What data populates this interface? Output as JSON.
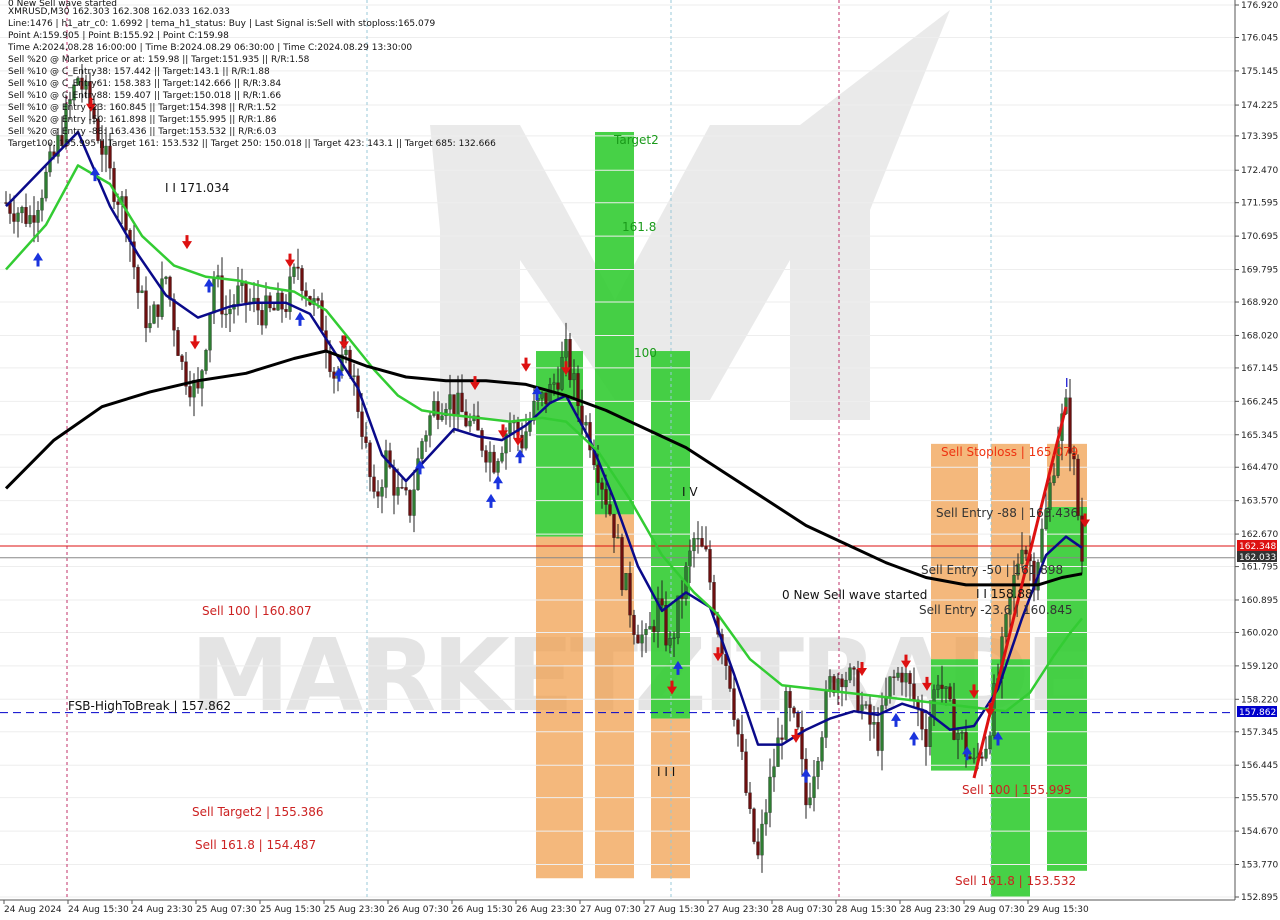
{
  "header": {
    "lines": [
      "0 New Sell wave started",
      "XMRUSD,M30  162.303 162.308 162.033 162.033",
      "Line:1476  |  h1_atr_c0: 1.6992  |  tema_h1_status: Buy  |  Last Signal is:Sell with stoploss:165.079",
      "Point A:159.905  |  Point B:155.92  |  Point C:159.98",
      "Time A:2024.08.28 16:00:00  |  Time B:2024.08.29 06:30:00  |  Time C:2024.08.29 13:30:00",
      "Sell %20 @ Market price or at: 159.98  ||  Target:151.935  ||  R/R:1.58",
      "Sell %10 @ C_Entry38: 157.442  ||  Target:143.1  ||  R/R:1.88",
      "Sell %10 @ C_Entry61: 158.383  ||  Target:142.666  ||  R/R:3.84",
      "Sell %10 @ C_Entry88: 159.407  ||  Target:150.018  ||  R/R:1.66",
      "Sell %10 @ Entry -23: 160.845  ||  Target:154.398  ||  R/R:1.52",
      "Sell %20 @ Entry -50: 161.898  ||  Target:155.995  ||  R/R:1.86",
      "Sell %20 @ Entry -88: 163.436  ||  Target:153.532  ||  R/R:6.03",
      "Target100: 155.995  ||  Target 161: 153.532  ||  Target 250: 150.018  ||  Target 423: 143.1  ||  Target 685: 132.666"
    ]
  },
  "watermark": "MARKETZITRADE",
  "annotations": {
    "level_171": "I I 171.034",
    "target2": "Target2",
    "fib_161": "161.8",
    "fib_100": "100",
    "wave_iv": "I V",
    "wave_iii": "I I I",
    "wave_i": "I",
    "new_sell_wave": "0 New Sell wave started",
    "sell_100_left": "Sell 100 | 160.807",
    "sell_target2": "Sell Target2 | 155.386",
    "sell_161_left": "Sell 161.8 | 154.487",
    "fsb": "FSB-HighToBreak  |  157.862",
    "sell_stoploss": "Sell Stoploss | 165.079",
    "sell_entry_88": "Sell Entry -88 | 163.436",
    "sell_entry_50": "Sell Entry -50 | 161.898",
    "sell_entry_23": "Sell Entry -23.6 | 160.845",
    "sell_100_right": "Sell 100 | 155.995",
    "sell_161_right": "Sell 161.8 | 153.532",
    "partial_level": "I I 158.88"
  },
  "price_tags": {
    "ask": "162.348",
    "bid": "162.033",
    "fsb": "157.862"
  },
  "colors": {
    "green": "#33cc33",
    "orange": "#f0a050",
    "red": "#dd1111",
    "navy": "#0a0a8a",
    "ma_green": "#33cc33",
    "ma_black": "#000000",
    "fsb_blue": "#0000cc",
    "annotation_red": "#cc2222"
  },
  "chart_data": {
    "type": "candlestick",
    "symbol": "XMRUSD",
    "timeframe": "M30",
    "ylim": [
      152.895,
      176.92
    ],
    "y_ticks": [
      "176.920",
      "176.045",
      "175.145",
      "174.225",
      "173.395",
      "172.470",
      "171.595",
      "170.695",
      "169.795",
      "168.920",
      "168.020",
      "167.145",
      "166.245",
      "165.345",
      "164.470",
      "163.570",
      "162.670",
      "161.795",
      "160.895",
      "160.020",
      "159.120",
      "158.220",
      "157.345",
      "156.445",
      "155.570",
      "154.670",
      "153.770",
      "152.895"
    ],
    "x_ticks": [
      "24 Aug 2024",
      "24 Aug 15:30",
      "24 Aug 23:30",
      "25 Aug 07:30",
      "25 Aug 15:30",
      "25 Aug 23:30",
      "26 Aug 07:30",
      "26 Aug 15:30",
      "26 Aug 23:30",
      "27 Aug 07:30",
      "27 Aug 15:30",
      "27 Aug 23:30",
      "28 Aug 07:30",
      "28 Aug 15:30",
      "28 Aug 23:30",
      "29 Aug 07:30",
      "29 Aug 15:30"
    ],
    "n_bars": 270,
    "close_anchors": [
      [
        0,
        171.6
      ],
      [
        6,
        171.2
      ],
      [
        12,
        172.8
      ],
      [
        18,
        175.0
      ],
      [
        22,
        173.9
      ],
      [
        26,
        172.3
      ],
      [
        30,
        171.3
      ],
      [
        33,
        169.2
      ],
      [
        36,
        168.2
      ],
      [
        40,
        169.6
      ],
      [
        44,
        167.2
      ],
      [
        48,
        166.4
      ],
      [
        52,
        169.6
      ],
      [
        55,
        168.6
      ],
      [
        58,
        169.1
      ],
      [
        62,
        168.8
      ],
      [
        66,
        168.6
      ],
      [
        70,
        168.9
      ],
      [
        73,
        169.9
      ],
      [
        76,
        169.0
      ],
      [
        79,
        168.4
      ],
      [
        82,
        167.0
      ],
      [
        86,
        167.3
      ],
      [
        89,
        165.6
      ],
      [
        92,
        163.4
      ],
      [
        95,
        164.7
      ],
      [
        98,
        163.7
      ],
      [
        101,
        163.4
      ],
      [
        104,
        165.2
      ],
      [
        107,
        166.1
      ],
      [
        110,
        166.4
      ],
      [
        114,
        165.9
      ],
      [
        118,
        165.3
      ],
      [
        122,
        164.7
      ],
      [
        126,
        165.7
      ],
      [
        129,
        165.2
      ],
      [
        132,
        166.0
      ],
      [
        136,
        166.5
      ],
      [
        140,
        167.5
      ],
      [
        143,
        166.2
      ],
      [
        146,
        165.3
      ],
      [
        149,
        164.1
      ],
      [
        152,
        162.9
      ],
      [
        154,
        161.6
      ],
      [
        157,
        160.3
      ],
      [
        160,
        159.7
      ],
      [
        163,
        160.7
      ],
      [
        166,
        159.6
      ],
      [
        169,
        161.1
      ],
      [
        172,
        162.5
      ],
      [
        175,
        162.0
      ],
      [
        178,
        160.2
      ],
      [
        181,
        158.8
      ],
      [
        184,
        156.5
      ],
      [
        186,
        154.9
      ],
      [
        188,
        153.9
      ],
      [
        190,
        155.3
      ],
      [
        192,
        156.5
      ],
      [
        195,
        158.0
      ],
      [
        198,
        157.2
      ],
      [
        200,
        155.4
      ],
      [
        203,
        157.0
      ],
      [
        206,
        158.6
      ],
      [
        209,
        159.0
      ],
      [
        212,
        158.6
      ],
      [
        215,
        157.7
      ],
      [
        218,
        157.2
      ],
      [
        221,
        158.6
      ],
      [
        224,
        159.0
      ],
      [
        227,
        158.2
      ],
      [
        230,
        157.3
      ],
      [
        233,
        158.9
      ],
      [
        236,
        157.8
      ],
      [
        239,
        157.1
      ],
      [
        242,
        156.4
      ],
      [
        245,
        157.1
      ],
      [
        248,
        158.8
      ],
      [
        251,
        160.8
      ],
      [
        254,
        162.6
      ],
      [
        257,
        161.6
      ],
      [
        260,
        163.2
      ],
      [
        263,
        165.4
      ],
      [
        265,
        166.0
      ],
      [
        267,
        164.4
      ],
      [
        269,
        162.0
      ]
    ],
    "moving_averages": [
      {
        "name": "",
        "color": "#0a0a8a",
        "points": [
          [
            0,
            171.5
          ],
          [
            18,
            173.5
          ],
          [
            26,
            171.5
          ],
          [
            33,
            170.2
          ],
          [
            40,
            169.1
          ],
          [
            48,
            168.5
          ],
          [
            56,
            168.8
          ],
          [
            62,
            168.9
          ],
          [
            70,
            168.9
          ],
          [
            76,
            168.6
          ],
          [
            82,
            167.6
          ],
          [
            88,
            166.6
          ],
          [
            94,
            164.8
          ],
          [
            100,
            164.1
          ],
          [
            106,
            164.8
          ],
          [
            112,
            165.5
          ],
          [
            118,
            165.3
          ],
          [
            124,
            165.2
          ],
          [
            130,
            165.6
          ],
          [
            136,
            166.2
          ],
          [
            140,
            166.4
          ],
          [
            146,
            165.2
          ],
          [
            152,
            163.6
          ],
          [
            158,
            161.8
          ],
          [
            164,
            160.6
          ],
          [
            170,
            161.1
          ],
          [
            176,
            160.7
          ],
          [
            182,
            158.9
          ],
          [
            188,
            157.0
          ],
          [
            194,
            157.0
          ],
          [
            200,
            157.4
          ],
          [
            206,
            157.7
          ],
          [
            212,
            157.9
          ],
          [
            218,
            157.8
          ],
          [
            224,
            158.1
          ],
          [
            230,
            157.9
          ],
          [
            236,
            157.4
          ],
          [
            242,
            157.5
          ],
          [
            248,
            158.5
          ],
          [
            254,
            160.4
          ],
          [
            260,
            162.1
          ],
          [
            265,
            162.6
          ],
          [
            269,
            162.3
          ]
        ]
      },
      {
        "name": "",
        "color": "#33cc33",
        "points": [
          [
            0,
            169.8
          ],
          [
            10,
            171.0
          ],
          [
            18,
            172.6
          ],
          [
            26,
            172.1
          ],
          [
            34,
            170.7
          ],
          [
            42,
            169.9
          ],
          [
            50,
            169.6
          ],
          [
            58,
            169.5
          ],
          [
            66,
            169.3
          ],
          [
            72,
            169.2
          ],
          [
            80,
            168.7
          ],
          [
            86,
            167.9
          ],
          [
            92,
            167.1
          ],
          [
            98,
            166.4
          ],
          [
            104,
            166.0
          ],
          [
            110,
            165.9
          ],
          [
            118,
            165.8
          ],
          [
            126,
            165.7
          ],
          [
            134,
            165.8
          ],
          [
            140,
            165.7
          ],
          [
            148,
            164.9
          ],
          [
            156,
            163.6
          ],
          [
            164,
            162.1
          ],
          [
            172,
            161.1
          ],
          [
            178,
            160.5
          ],
          [
            186,
            159.3
          ],
          [
            194,
            158.6
          ],
          [
            202,
            158.5
          ],
          [
            210,
            158.4
          ],
          [
            218,
            158.3
          ],
          [
            226,
            158.2
          ],
          [
            234,
            158.1
          ],
          [
            242,
            158.0
          ],
          [
            250,
            157.9
          ],
          [
            256,
            158.4
          ],
          [
            262,
            159.4
          ],
          [
            266,
            160.0
          ],
          [
            269,
            160.4
          ]
        ]
      },
      {
        "name": "",
        "color": "#000000",
        "points": [
          [
            0,
            163.9
          ],
          [
            12,
            165.2
          ],
          [
            24,
            166.1
          ],
          [
            36,
            166.5
          ],
          [
            48,
            166.8
          ],
          [
            60,
            167.0
          ],
          [
            72,
            167.4
          ],
          [
            80,
            167.6
          ],
          [
            90,
            167.2
          ],
          [
            100,
            166.9
          ],
          [
            110,
            166.8
          ],
          [
            120,
            166.8
          ],
          [
            130,
            166.7
          ],
          [
            140,
            166.4
          ],
          [
            150,
            166.0
          ],
          [
            160,
            165.5
          ],
          [
            170,
            165.0
          ],
          [
            180,
            164.3
          ],
          [
            190,
            163.6
          ],
          [
            200,
            162.9
          ],
          [
            210,
            162.4
          ],
          [
            220,
            161.9
          ],
          [
            230,
            161.5
          ],
          [
            240,
            161.3
          ],
          [
            250,
            161.3
          ],
          [
            258,
            161.3
          ],
          [
            264,
            161.5
          ],
          [
            269,
            161.6
          ]
        ]
      }
    ],
    "zones": [
      {
        "color": "green",
        "x0": 536,
        "x1": 583,
        "top": 167.6,
        "bottom": 162.6
      },
      {
        "color": "orange",
        "x0": 536,
        "x1": 583,
        "top": 162.6,
        "bottom": 153.4
      },
      {
        "color": "green",
        "x0": 595,
        "x1": 634,
        "top": 173.5,
        "bottom": 163.2
      },
      {
        "color": "orange",
        "x0": 595,
        "x1": 634,
        "top": 163.2,
        "bottom": 153.4
      },
      {
        "color": "green",
        "x0": 651,
        "x1": 690,
        "top": 167.6,
        "bottom": 157.7
      },
      {
        "color": "orange",
        "x0": 651,
        "x1": 690,
        "top": 157.7,
        "bottom": 153.4
      },
      {
        "color": "orange",
        "x0": 931,
        "x1": 978,
        "top": 165.1,
        "bottom": 159.3
      },
      {
        "color": "green",
        "x0": 931,
        "x1": 978,
        "top": 159.3,
        "bottom": 156.3
      },
      {
        "color": "orange",
        "x0": 991,
        "x1": 1030,
        "top": 165.1,
        "bottom": 159.3
      },
      {
        "color": "green",
        "x0": 991,
        "x1": 1030,
        "top": 159.3,
        "bottom": 152.9
      },
      {
        "color": "orange",
        "x0": 1047,
        "x1": 1087,
        "top": 165.1,
        "bottom": 163.4
      },
      {
        "color": "green",
        "x0": 1047,
        "x1": 1087,
        "top": 163.4,
        "bottom": 153.6
      }
    ],
    "vlines": [
      {
        "x": 67,
        "color": "#c0306a"
      },
      {
        "x": 367,
        "color": "#99c8d8"
      },
      {
        "x": 671,
        "color": "#99c8d8"
      },
      {
        "x": 839,
        "color": "#c0306a"
      },
      {
        "x": 991,
        "color": "#99c8d8"
      }
    ],
    "hlines": [
      {
        "price": 162.348,
        "color": "#dd1111",
        "style": "solid"
      },
      {
        "price": 162.033,
        "color": "#888888",
        "style": "solid"
      },
      {
        "price": 157.862,
        "color": "#0000cc",
        "style": "dashed"
      }
    ],
    "red_line": {
      "from": [
        974,
        156.1
      ],
      "to": [
        1066,
        166.1
      ]
    },
    "sell_arrows": [
      [
        91,
        174.1
      ],
      [
        187,
        170.4
      ],
      [
        290,
        169.9
      ],
      [
        195,
        167.7
      ],
      [
        344,
        167.7
      ],
      [
        475,
        166.6
      ],
      [
        526,
        167.1
      ],
      [
        566,
        167.0
      ],
      [
        503,
        165.3
      ],
      [
        518,
        165.1
      ],
      [
        906,
        159.1
      ],
      [
        862,
        158.9
      ],
      [
        927,
        158.5
      ],
      [
        974,
        158.3
      ],
      [
        990,
        157.8
      ],
      [
        796,
        157.1
      ],
      [
        718,
        159.3
      ],
      [
        672,
        158.4
      ],
      [
        1085,
        162.9
      ]
    ],
    "buy_arrows": [
      [
        38,
        170.2
      ],
      [
        95,
        172.5
      ],
      [
        209,
        169.5
      ],
      [
        300,
        168.6
      ],
      [
        339,
        167.1
      ],
      [
        420,
        164.6
      ],
      [
        498,
        164.2
      ],
      [
        491,
        163.7
      ],
      [
        520,
        164.9
      ],
      [
        537,
        166.6
      ],
      [
        678,
        159.2
      ],
      [
        806,
        156.3
      ],
      [
        896,
        157.8
      ],
      [
        914,
        157.3
      ],
      [
        967,
        156.9
      ],
      [
        998,
        157.3
      ]
    ]
  }
}
